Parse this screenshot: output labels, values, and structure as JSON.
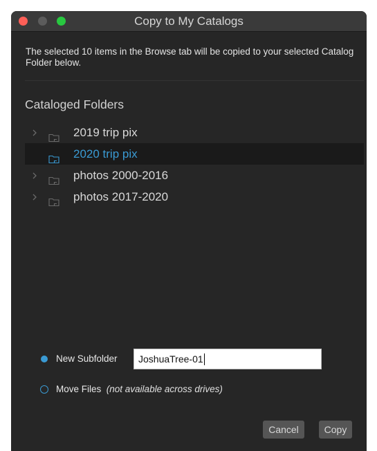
{
  "window": {
    "title": "Copy to My Catalogs"
  },
  "description": "The selected 10 items in the Browse tab will be copied to your selected Catalog Folder below.",
  "section_title": "Cataloged Folders",
  "folders": [
    {
      "label": "2019 trip pix",
      "expandable": true,
      "selected": false
    },
    {
      "label": "2020 trip pix",
      "expandable": false,
      "selected": true
    },
    {
      "label": "photos 2000-2016",
      "expandable": true,
      "selected": false
    },
    {
      "label": "photos 2017-2020",
      "expandable": true,
      "selected": false
    }
  ],
  "options": {
    "new_subfolder_label": "New Subfolder",
    "new_subfolder_value": "JoshuaTree-01",
    "move_files_label": "Move Files",
    "move_files_note": "(not available across drives)",
    "selected": "new_subfolder"
  },
  "buttons": {
    "cancel": "Cancel",
    "copy": "Copy"
  },
  "colors": {
    "accent": "#3a9ad3",
    "window_bg": "#262626",
    "titlebar_bg": "#3a3a3a",
    "close": "#fe5f57",
    "minimize": "#5c5c5c",
    "maximize": "#28c840"
  },
  "icons": {
    "chevron": "chevron-right-icon",
    "folder": "folder-icon"
  }
}
